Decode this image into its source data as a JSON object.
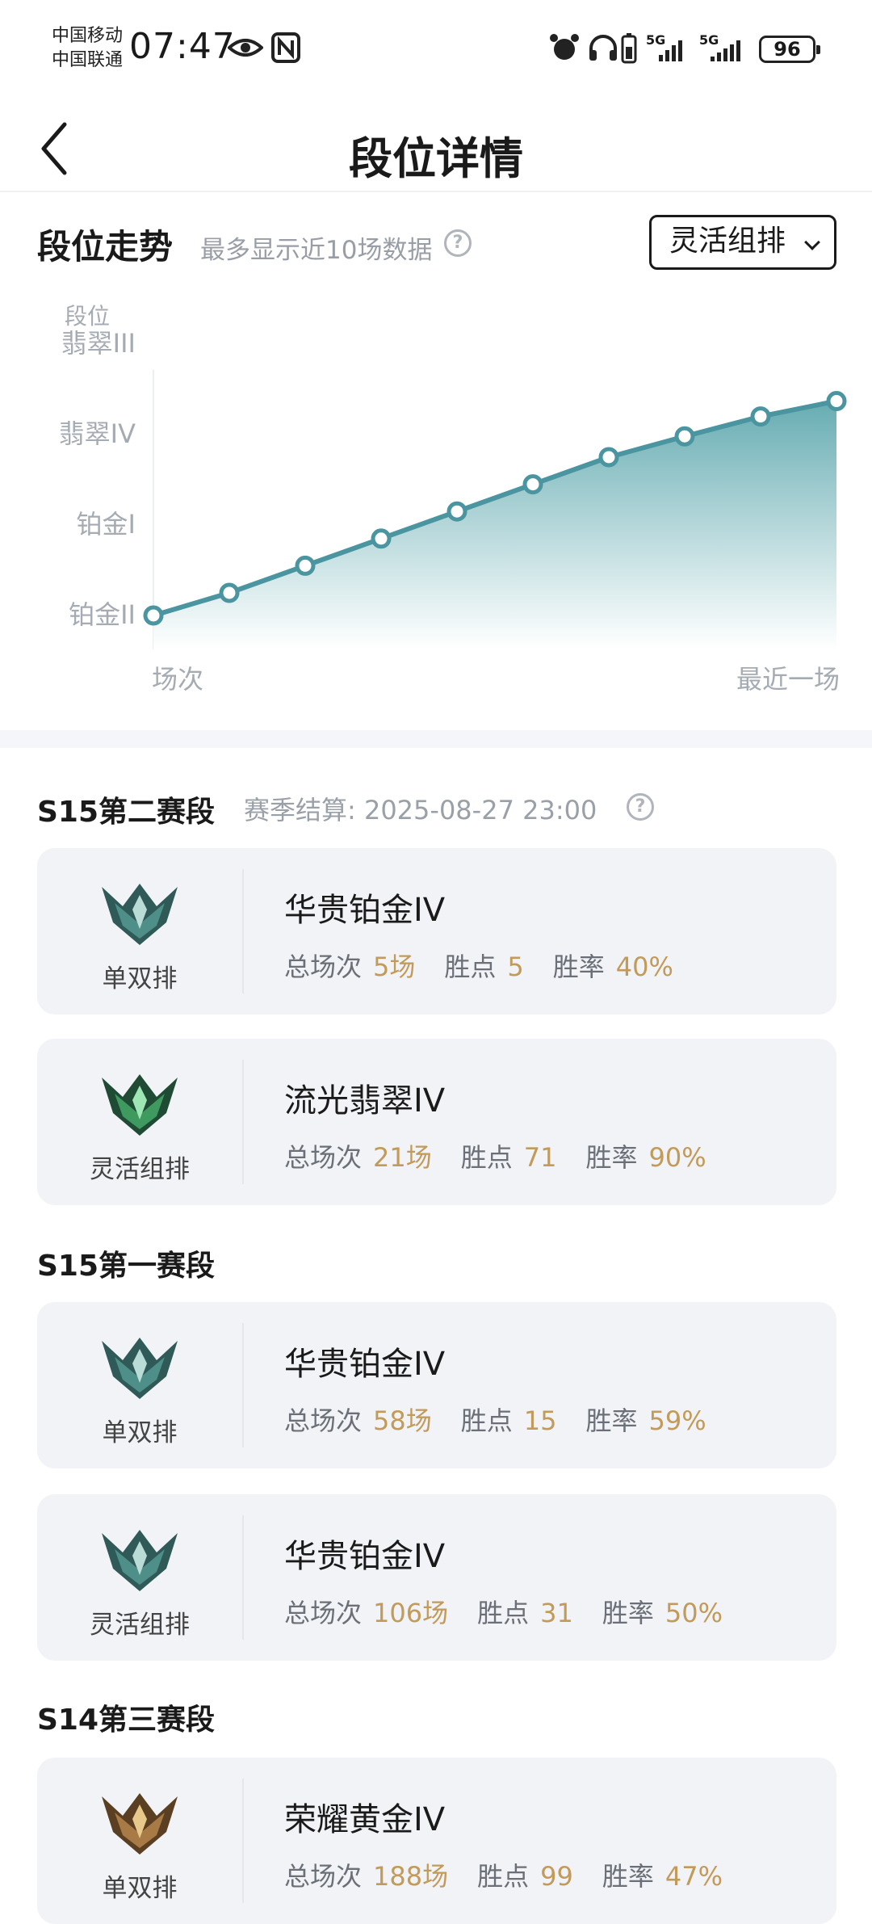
{
  "status_bar": {
    "carrier1": "中国移动",
    "carrier2": "中国联通",
    "time": "07:47",
    "signal1": "5G",
    "signal2": "5G",
    "battery": "96"
  },
  "header": {
    "title": "段位详情"
  },
  "trend": {
    "title": "段位走势",
    "subtitle": "最多显示近10场数据",
    "mode_selected": "灵活组排"
  },
  "chart_data": {
    "type": "area",
    "ylabel": "段位",
    "y_ticks": [
      "铂金II",
      "铂金I",
      "翡翠IV",
      "翡翠III"
    ],
    "x_start_label": "场次",
    "x_end_label": "最近一场",
    "x": [
      1,
      2,
      3,
      4,
      5,
      6,
      7,
      8,
      9,
      10
    ],
    "values": [
      0.0,
      0.25,
      0.55,
      0.85,
      1.15,
      1.45,
      1.75,
      1.98,
      2.2,
      2.37
    ],
    "ylim": [
      0,
      3
    ],
    "grid": false,
    "colors": {
      "line": "#4a95a0",
      "fill_top": "#6fb2b8",
      "fill_bottom": "#ffffff"
    }
  },
  "seasons": [
    {
      "title": "S15第二赛段",
      "note": "赛季结算: 2025-08-27 23:00",
      "cards": [
        {
          "queue": "单双排",
          "rank": "华贵铂金IV",
          "games_label": "总场次",
          "games": "5场",
          "lp_label": "胜点",
          "lp": "5",
          "wr_label": "胜率",
          "wr": "40%",
          "emblem": "platinum-emblem-icon"
        },
        {
          "queue": "灵活组排",
          "rank": "流光翡翠IV",
          "games_label": "总场次",
          "games": "21场",
          "lp_label": "胜点",
          "lp": "71",
          "wr_label": "胜率",
          "wr": "90%",
          "emblem": "emerald-emblem-icon"
        }
      ]
    },
    {
      "title": "S15第一赛段",
      "note": "",
      "cards": [
        {
          "queue": "单双排",
          "rank": "华贵铂金IV",
          "games_label": "总场次",
          "games": "58场",
          "lp_label": "胜点",
          "lp": "15",
          "wr_label": "胜率",
          "wr": "59%",
          "emblem": "platinum-emblem-icon"
        },
        {
          "queue": "灵活组排",
          "rank": "华贵铂金IV",
          "games_label": "总场次",
          "games": "106场",
          "lp_label": "胜点",
          "lp": "31",
          "wr_label": "胜率",
          "wr": "50%",
          "emblem": "platinum-emblem-icon"
        }
      ]
    },
    {
      "title": "S14第三赛段",
      "note": "",
      "cards": [
        {
          "queue": "单双排",
          "rank": "荣耀黄金IV",
          "games_label": "总场次",
          "games": "188场",
          "lp_label": "胜点",
          "lp": "99",
          "wr_label": "胜率",
          "wr": "47%",
          "emblem": "gold-emblem-icon"
        }
      ]
    }
  ]
}
